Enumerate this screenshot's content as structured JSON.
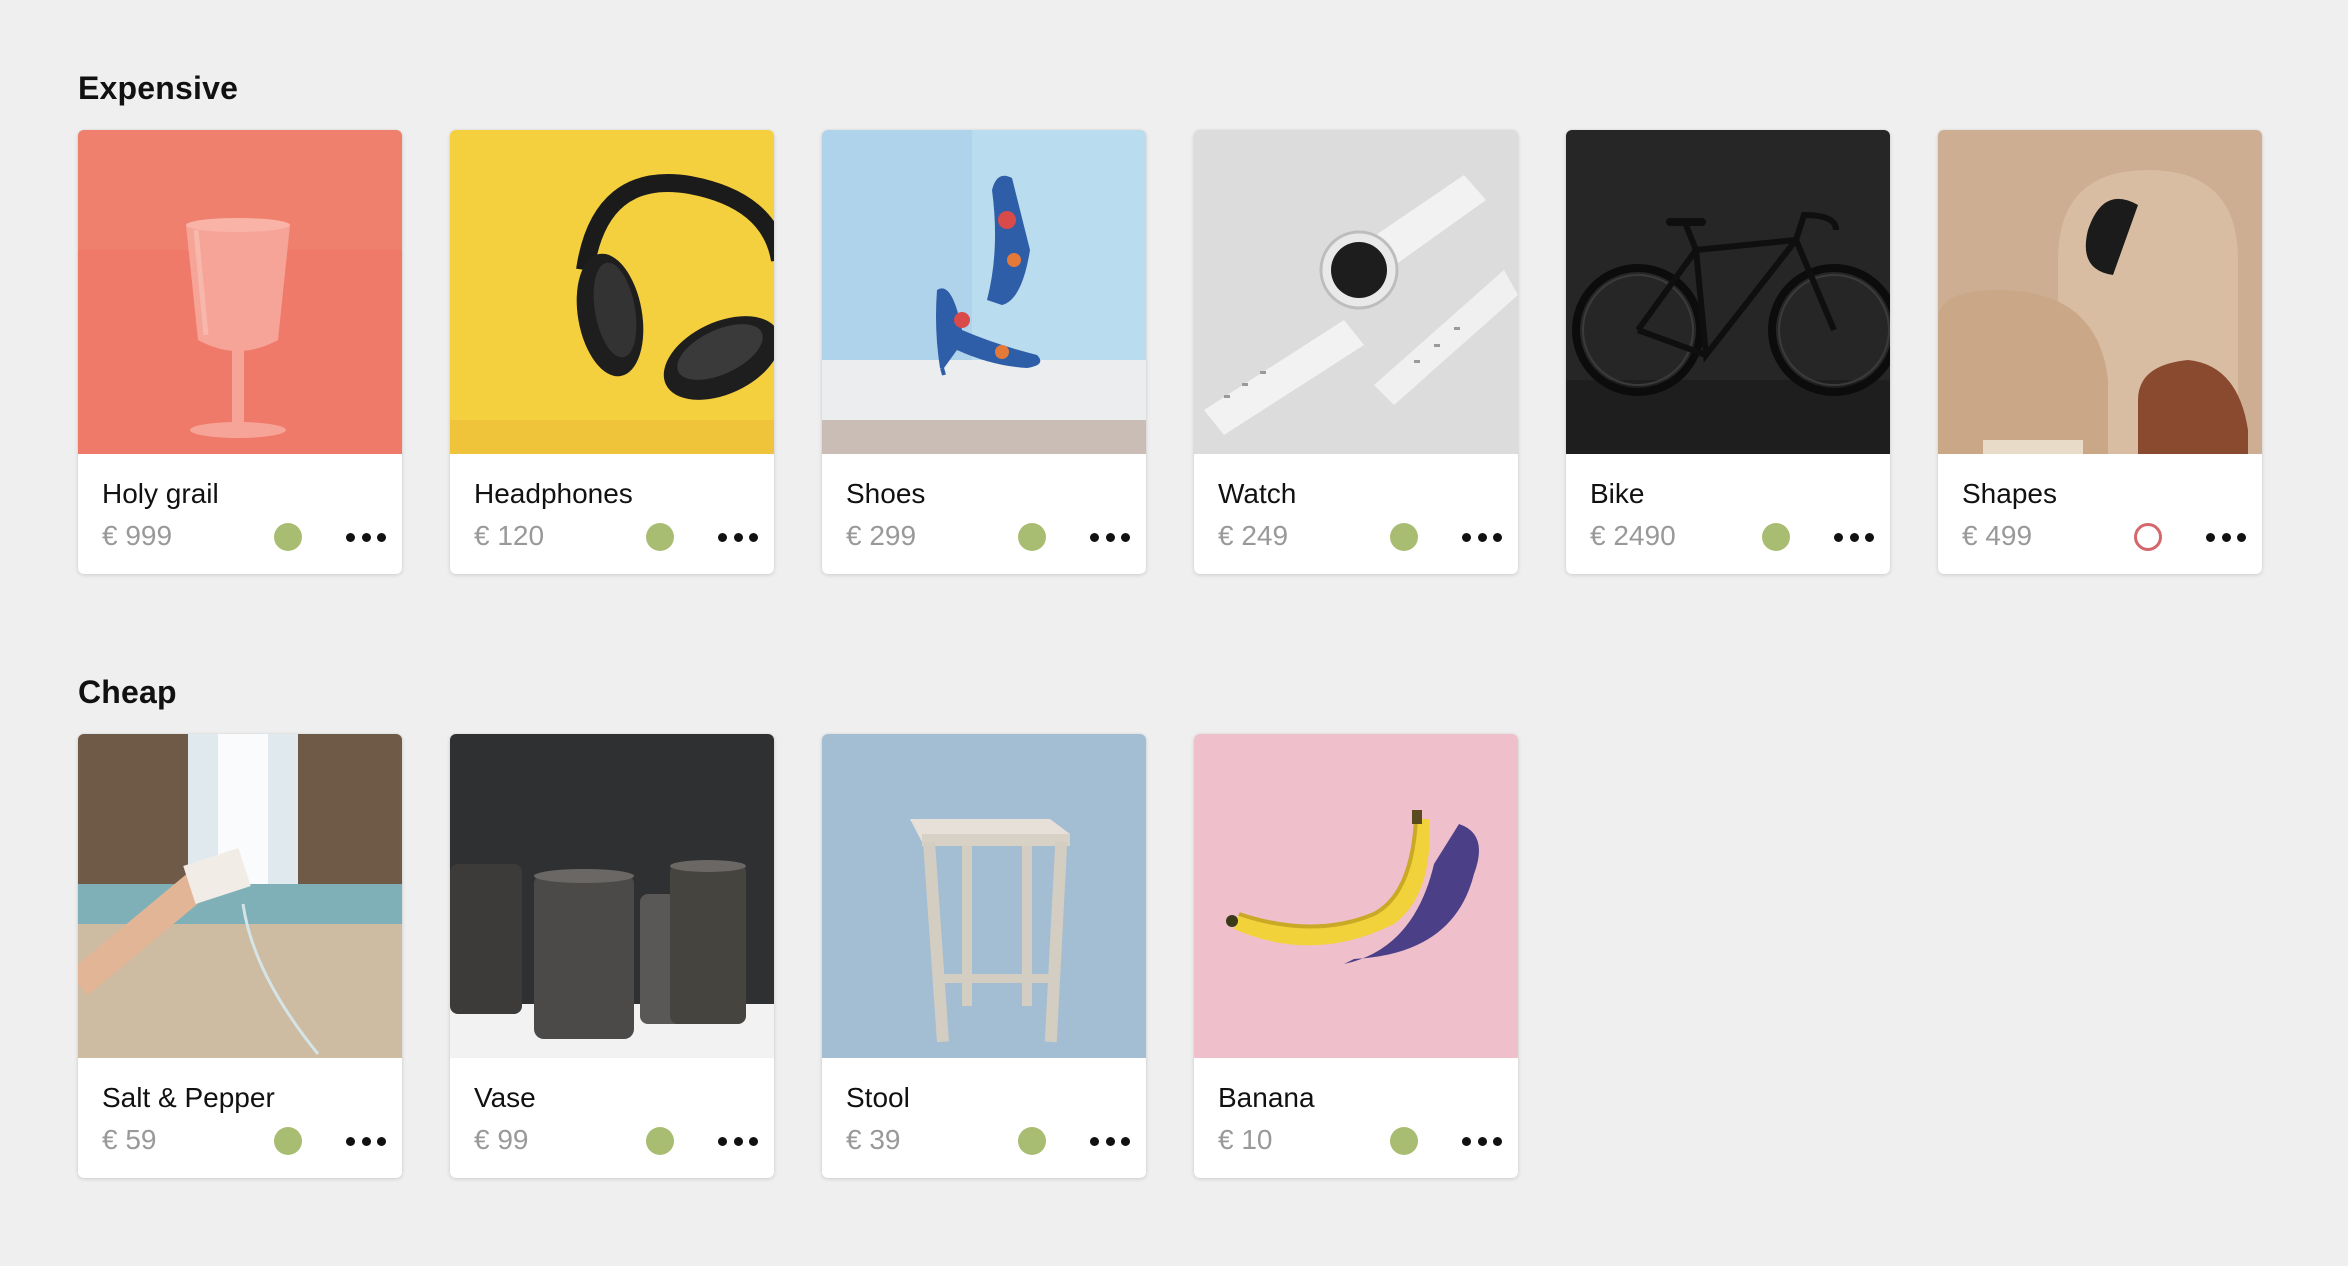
{
  "sections": [
    {
      "title": "Expensive",
      "items": [
        {
          "name": "Holy grail",
          "price": "€ 999",
          "available": true,
          "image": "pink-goblet",
          "bg": "#ef7a6a"
        },
        {
          "name": "Headphones",
          "price": "€ 120",
          "available": true,
          "image": "black-headphones",
          "bg": "#f4cf3e"
        },
        {
          "name": "Shoes",
          "price": "€ 299",
          "available": true,
          "image": "floral-heels",
          "bg": "#b9dcef"
        },
        {
          "name": "Watch",
          "price": "€ 249",
          "available": true,
          "image": "smartwatch",
          "bg": "#dcdcdc"
        },
        {
          "name": "Bike",
          "price": "€ 2490",
          "available": true,
          "image": "road-bike",
          "bg": "#2a2a2a"
        },
        {
          "name": "Shapes",
          "price": "€ 499",
          "available": false,
          "image": "abstract-shapes",
          "bg": "#c8a888"
        }
      ]
    },
    {
      "title": "Cheap",
      "items": [
        {
          "name": "Salt & Pepper",
          "price": "€ 59",
          "available": true,
          "image": "waterfall-carton",
          "bg": "#8a9a88"
        },
        {
          "name": "Vase",
          "price": "€ 99",
          "available": true,
          "image": "ceramic-vases",
          "bg": "#3a3c3e"
        },
        {
          "name": "Stool",
          "price": "€ 39",
          "available": true,
          "image": "wooden-stool",
          "bg": "#a3bdd3"
        },
        {
          "name": "Banana",
          "price": "€ 10",
          "available": true,
          "image": "banana",
          "bg": "#efc0cc"
        }
      ]
    }
  ],
  "colors": {
    "available": "#a9bd72",
    "unavailable": "#d4676b"
  }
}
